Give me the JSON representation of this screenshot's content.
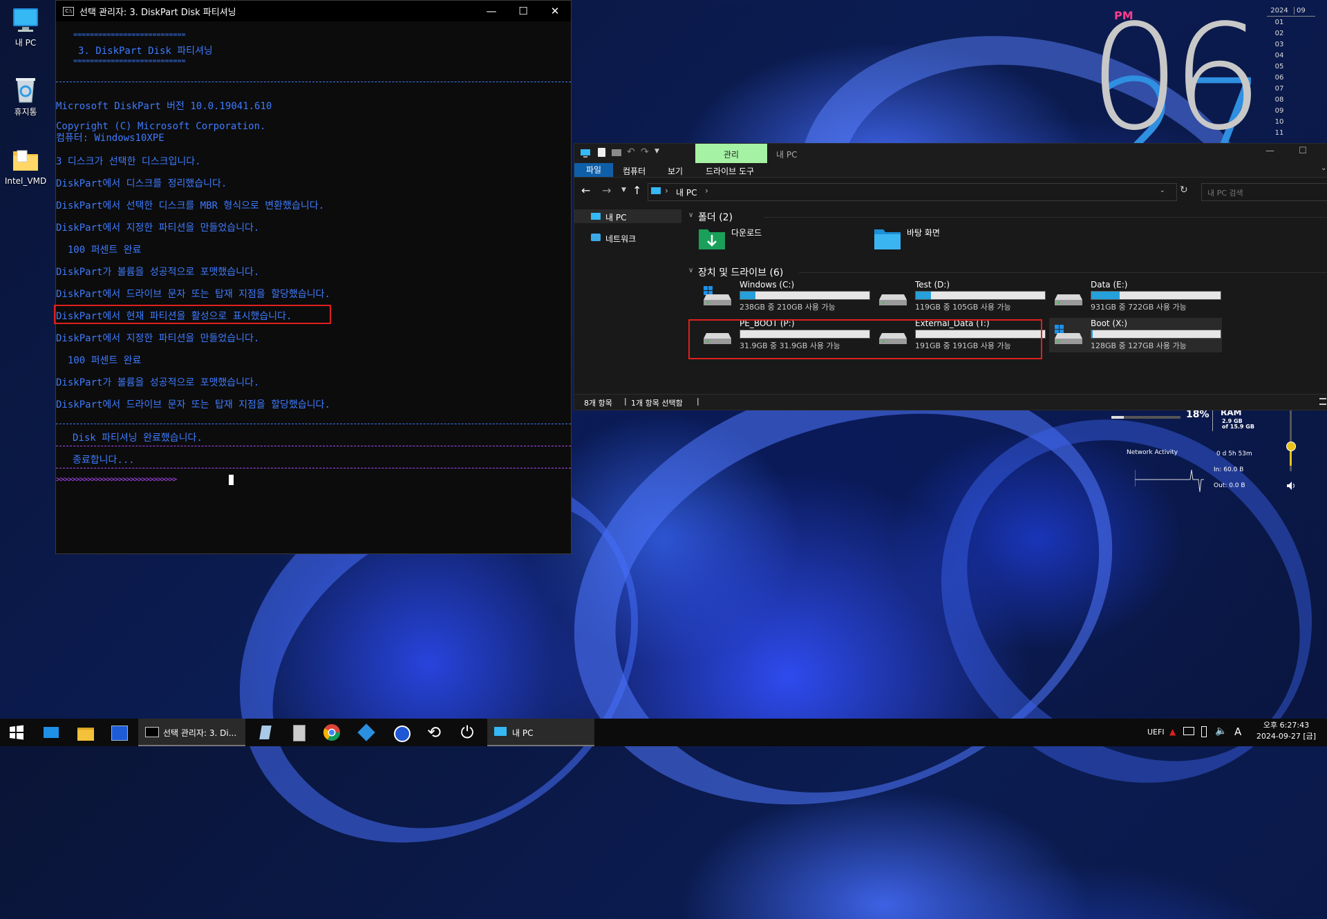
{
  "desktop": {
    "icons": [
      {
        "label": "내 PC",
        "icon": "monitor-icon"
      },
      {
        "label": "휴지통",
        "icon": "recycle-bin-icon"
      },
      {
        "label": "Intel_VMD",
        "icon": "folder-icon"
      }
    ]
  },
  "console": {
    "title": "선택 관리자:  3. DiskPart Disk 파티셔닝",
    "banner_rule": "===========================",
    "banner_title": "3. DiskPart Disk 파티셔닝",
    "lines": [
      "Microsoft DiskPart 버전 10.0.19041.610",
      "Copyright (C) Microsoft Corporation.",
      "컴퓨터: Windows10XPE",
      "3 디스크가 선택한 디스크입니다.",
      "DiskPart에서 디스크를 정리했습니다.",
      "DiskPart에서 선택한 디스크를 MBR 형식으로 변환했습니다.",
      "DiskPart에서 지정한 파티션을 만들었습니다.",
      "  100 퍼센트 완료",
      "DiskPart가 볼륨을 성공적으로 포맷했습니다.",
      "DiskPart에서 드라이브 문자 또는 탑재 지점을 할당했습니다.",
      "DiskPart에서 현재 파티션을 활성으로 표시했습니다.",
      "DiskPart에서 지정한 파티션을 만들었습니다.",
      "  100 퍼센트 완료",
      "DiskPart가 볼륨을 성공적으로 포맷했습니다.",
      "DiskPart에서 드라이브 문자 또는 탑재 지점을 할당했습니다."
    ],
    "done_msg": "Disk 파티셔닝 완료했습니다.",
    "exit_msg": "종료합니다...",
    "prompt": ">>>>>>>>>>>>>>>>>>>>>>>>>>>>>>>"
  },
  "explorer": {
    "context_tab": "관리",
    "title": "내 PC",
    "ribbon_tabs": [
      "파일",
      "컴퓨터",
      "보기",
      "드라이브 도구"
    ],
    "address": "내 PC",
    "search_placeholder": "내 PC 검색",
    "nav": [
      "내 PC",
      "네트워크"
    ],
    "folders_header": "폴더 (2)",
    "folders": [
      "다운로드",
      "바탕 화면"
    ],
    "drives_header": "장치 및 드라이브 (6)",
    "drives": [
      {
        "name": "Windows (C:)",
        "info": "238GB 중 210GB 사용 가능",
        "used_fraction": 0.12,
        "windows_logo": true
      },
      {
        "name": "Test (D:)",
        "info": "119GB 중 105GB 사용 가능",
        "used_fraction": 0.12,
        "windows_logo": false
      },
      {
        "name": "Data (E:)",
        "info": "931GB 중 722GB 사용 가능",
        "used_fraction": 0.22,
        "windows_logo": false
      },
      {
        "name": "PE_BOOT (P:)",
        "info": "31.9GB 중 31.9GB 사용 가능",
        "used_fraction": 0.0,
        "windows_logo": false
      },
      {
        "name": "External_Data (T:)",
        "info": "191GB 중 191GB 사용 가능",
        "used_fraction": 0.0,
        "windows_logo": false
      },
      {
        "name": "Boot (X:)",
        "info": "128GB 중 127GB 사용 가능",
        "used_fraction": 0.01,
        "windows_logo": true
      }
    ],
    "status_items": "8개 항목",
    "status_selected": "1개 항목 선택함"
  },
  "widgets": {
    "clock_ampm": "PM",
    "clock_hour": "06",
    "clock_min_partial": "27",
    "calendar_year": "2024",
    "calendar_month": "09",
    "calendar_days": [
      "01",
      "02",
      "03",
      "04",
      "05",
      "06",
      "07",
      "08",
      "09",
      "10",
      "11"
    ],
    "ram_percent": "18%",
    "ram_label": "RAM",
    "ram_used": "2.9 GB",
    "ram_total": "of 15.9 GB",
    "ram_fraction": 0.18,
    "network_label": "Network Activity",
    "uptime": "0 d 5h 53m",
    "net_in": "In: 60.0 B",
    "net_out": "Out: 0.0 B"
  },
  "taskbar": {
    "console_task": "선택 관리자:  3. Di...",
    "explorer_task": "내 PC",
    "tray_uefi": "UEFI",
    "tray_ime": "A",
    "time": "오후 6:27:43",
    "date": "2024-09-27 [금]"
  },
  "colors": {
    "console_text": "#3e7bff",
    "console_divider": "#b04cff",
    "highlight": "#e0201e",
    "drive_bar": "#26a0da",
    "ribbon_active": "#0f5fa8",
    "context_tab_bg": "#a5f2a5"
  }
}
